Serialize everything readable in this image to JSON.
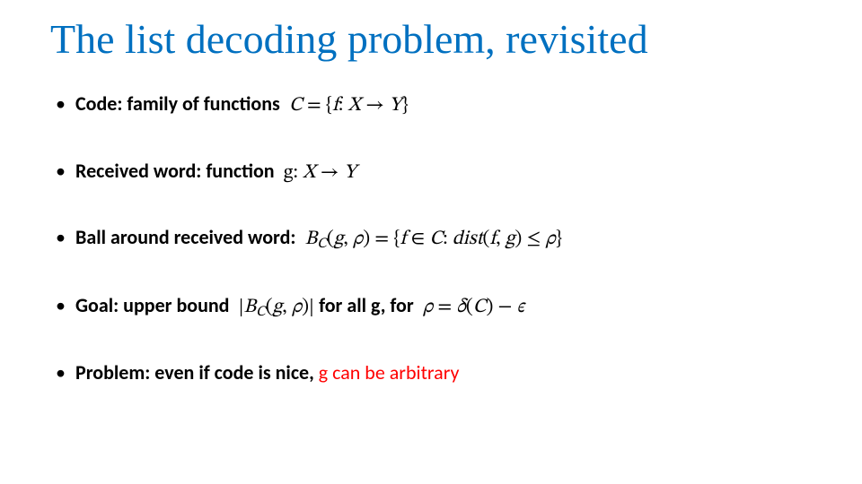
{
  "title": "The list decoding problem, revisited",
  "bullets": {
    "b1": {
      "label": "Code: family of functions",
      "math_C": "C",
      "math_eq": " = ",
      "math_lb": "{",
      "math_f": "f",
      "math_colon1": ": ",
      "math_X": "X",
      "math_arrow": " → ",
      "math_Y": "Y",
      "math_rb": "}"
    },
    "b2": {
      "label": "Received word: function",
      "math_g": "g",
      "math_colon": ": ",
      "math_X": "X",
      "math_arrow": " → ",
      "math_Y": "Y"
    },
    "b3": {
      "label": "Ball around received word:",
      "math_B": "B",
      "math_Csub": "C",
      "math_open": "(",
      "math_g": "g",
      "math_comma": ", ",
      "math_rho": "ρ",
      "math_close": ")",
      "math_eq": " = ",
      "math_lb": "{",
      "math_f": "f",
      "math_in": " ∈ ",
      "math_C": "C",
      "math_colon2": ": ",
      "math_dist": "dist",
      "math_open2": "(",
      "math_f2": "f",
      "math_comma2": ", ",
      "math_g2": "g",
      "math_close2": ")",
      "math_le": " ≤ ",
      "math_rho2": "ρ",
      "math_rb": "}"
    },
    "b4": {
      "label1": "Goal: upper bound",
      "math_bar1": "|",
      "math_B": "B",
      "math_Csub": "C",
      "math_open": "(",
      "math_g": "g",
      "math_comma": ", ",
      "math_rho": "ρ",
      "math_close": ")",
      "math_bar2": "|",
      "label2": " for all g, for",
      "math_rho2": "ρ",
      "math_eq": " = ",
      "math_delta": "δ",
      "math_open2": "(",
      "math_C": "C",
      "math_close2": ")",
      "math_minus": " − ",
      "math_eps": "ϵ"
    },
    "b5": {
      "label1": "Problem: even if code is nice, ",
      "label2_red": "g can be arbitrary"
    }
  }
}
